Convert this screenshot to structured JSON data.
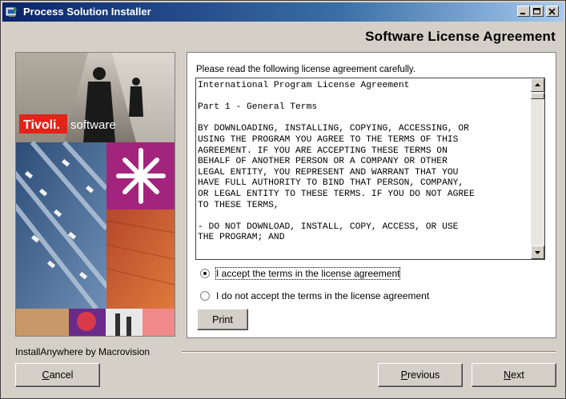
{
  "window": {
    "title": "Process Solution Installer"
  },
  "header": {
    "title": "Software License Agreement"
  },
  "banner": {
    "brand": "Tivoli.",
    "product": "software"
  },
  "license": {
    "instructions": "Please read the following license agreement carefully.",
    "text": "International Program License Agreement\n\nPart 1 - General Terms\n\nBY DOWNLOADING, INSTALLING, COPYING, ACCESSING, OR\nUSING THE PROGRAM YOU AGREE TO THE TERMS OF THIS\nAGREEMENT. IF YOU ARE ACCEPTING THESE TERMS ON\nBEHALF OF ANOTHER PERSON OR A COMPANY OR OTHER\nLEGAL ENTITY, YOU REPRESENT AND WARRANT THAT YOU\nHAVE FULL AUTHORITY TO BIND THAT PERSON, COMPANY,\nOR LEGAL ENTITY TO THESE TERMS. IF YOU DO NOT AGREE\nTO THESE TERMS,\n\n- DO NOT DOWNLOAD, INSTALL, COPY, ACCESS, OR USE\nTHE PROGRAM; AND"
  },
  "options": {
    "accept_label": "I accept the terms in the license agreement",
    "decline_label": "I do not accept the terms in the license agreement",
    "selected": "accept"
  },
  "buttons": {
    "print": "Print",
    "cancel_rest": "ancel",
    "cancel_mnemonic": "C",
    "previous_mnemonic": "P",
    "previous_rest": "revious",
    "next_mnemonic": "N",
    "next_rest": "ext"
  },
  "footer": {
    "vendor": "InstallAnywhere by Macrovision"
  },
  "colors": {
    "titlebar_start": "#0a246a",
    "titlebar_end": "#a6caf0",
    "tivoli_red": "#e2231a",
    "face": "#d4d0c8"
  }
}
